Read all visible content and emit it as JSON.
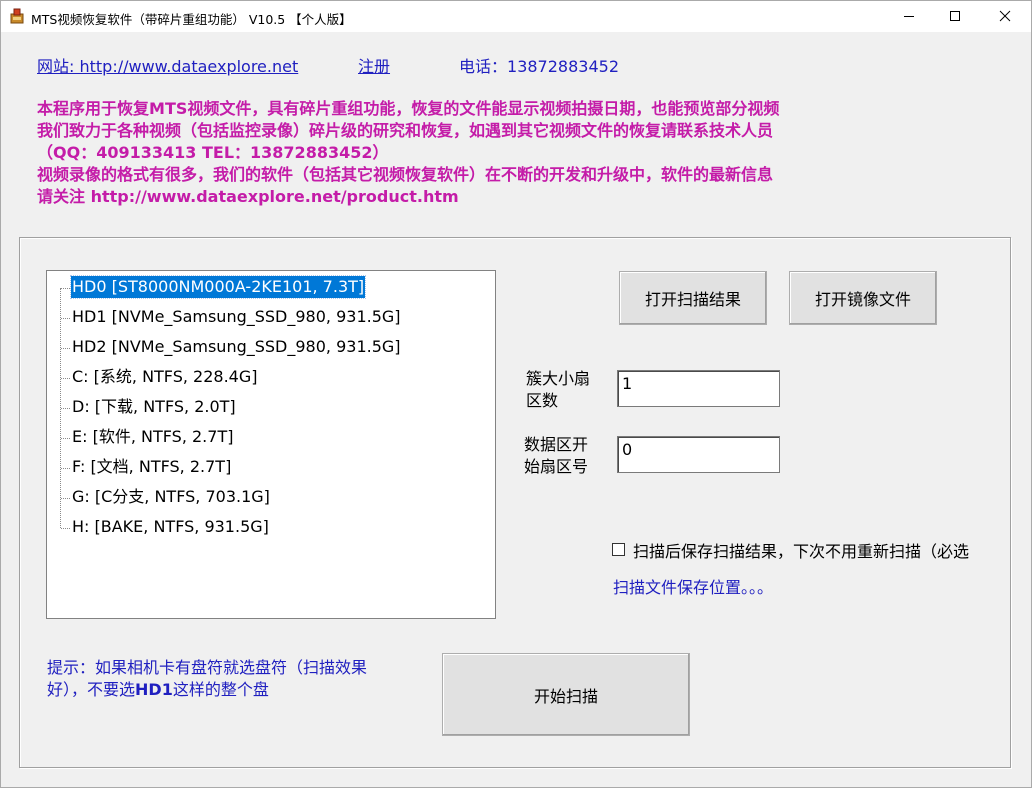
{
  "window": {
    "title": "MTS视频恢复软件（带碎片重组功能） V10.5 【个人版】",
    "minimize_icon": "minimize-icon",
    "maximize_icon": "maximize-icon",
    "close_icon": "close-icon"
  },
  "header": {
    "website_label": "网站: http://www.dataexplore.net",
    "register_label": "注册",
    "phone_prefix": "电话：",
    "phone_number": "13872883452"
  },
  "intro": {
    "line1_a": "本程序用于恢复",
    "line1_b": "MTS",
    "line1_c": "视频文件，具有碎片重组功能，恢复的文件能显示视频拍摄日期，也能预览部分视频",
    "line2": "我们致力于各种视频（包括监控录像）碎片级的研究和恢复，如遇到其它视频文件的恢复请联系技术人员",
    "line3_a": "（",
    "line3_b": "QQ：409133413  TEL：13872883452",
    "line3_c": "）",
    "line4": "视频录像的格式有很多，我们的软件（包括其它视频恢复软件）在不断的开发和升级中，软件的最新信息",
    "line5_a": "请关注 ",
    "line5_b": "http://www.dataexplore.net/product.htm"
  },
  "tree": {
    "items": [
      {
        "label": "HD0  [ST8000NM000A-2KE101, 7.3T]",
        "selected": true
      },
      {
        "label": "HD1  [NVMe_Samsung_SSD_980, 931.5G]"
      },
      {
        "label": "HD2  [NVMe_Samsung_SSD_980, 931.5G]"
      },
      {
        "label": "C:  [系统, NTFS, 228.4G]"
      },
      {
        "label": "D:  [下载, NTFS, 2.0T]"
      },
      {
        "label": "E:  [软件, NTFS, 2.7T]"
      },
      {
        "label": "F:  [文档, NTFS, 2.7T]"
      },
      {
        "label": "G:  [C分支, NTFS, 703.1G]"
      },
      {
        "label": "H:  [BAKE, NTFS, 931.5G]"
      }
    ]
  },
  "buttons": {
    "open_scan_result": "打开扫描结果",
    "open_image_file": "打开镜像文件",
    "start_scan": "开始扫描"
  },
  "fields": {
    "cluster_label": "簇大小扇区数",
    "cluster_value": "1",
    "data_start_label": "数据区开始扇区号",
    "data_start_value": "0"
  },
  "options": {
    "save_scan_checkbox_label": "扫描后保存扫描结果，下次不用重新扫描（必选",
    "save_scan_checked": false,
    "save_location_label": "扫描文件保存位置。。。"
  },
  "hint": {
    "line1": "提示：如果相机卡有盘符就选盘符（扫描效果",
    "line2_a": "好），不要选",
    "line2_b": "HD1",
    "line2_c": "这样的整个盘"
  },
  "colors": {
    "link_blue": "#2020c0",
    "intro_magenta": "#c41ca8",
    "selection_blue": "#0078d7"
  }
}
